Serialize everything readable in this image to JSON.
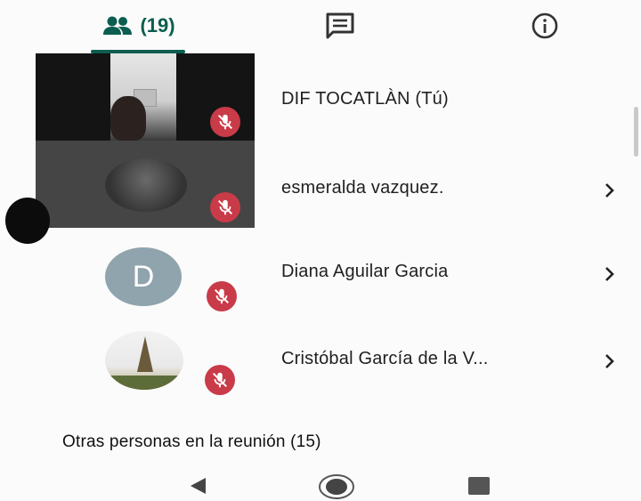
{
  "tabs": {
    "people": {
      "icon": "people-icon",
      "count": "(19)",
      "selected": true
    },
    "chat": {
      "icon": "chat-icon"
    },
    "info": {
      "icon": "info-icon"
    }
  },
  "participants": [
    {
      "name": "DIF TOCATLÀN (Tú)",
      "avatar": "video-tile",
      "muted": true,
      "chevron": false
    },
    {
      "name": "esmeralda vazquez.",
      "avatar": "video-tile",
      "muted": true,
      "chevron": true
    },
    {
      "name": "Diana Aguilar Garcia",
      "avatar_letter": "D",
      "muted": true,
      "chevron": true
    },
    {
      "name": "Cristóbal García de la V...",
      "avatar": "photo",
      "muted": true,
      "chevron": true
    }
  ],
  "section_label": "Otras personas en la reunión (15)",
  "navbar": {
    "back": "back-icon",
    "home": "home-icon",
    "recents": "recents-icon"
  },
  "colors": {
    "accent": "#0b5e4f",
    "mute_badge": "#c93b48",
    "letter_avatar": "#8fa4ad"
  }
}
